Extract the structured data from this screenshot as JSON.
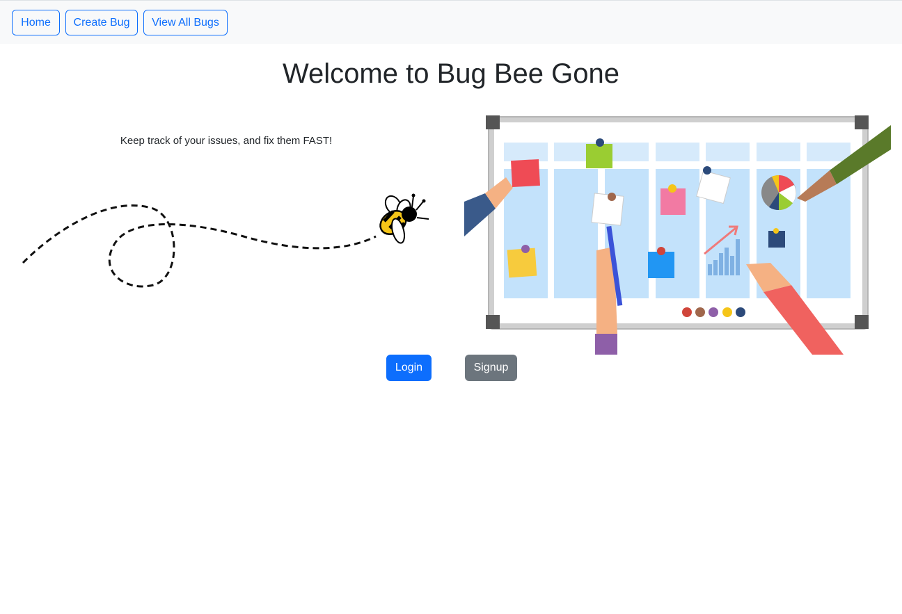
{
  "nav": {
    "home_label": "Home",
    "create_label": "Create Bug",
    "view_all_label": "View All Bugs"
  },
  "main": {
    "title": "Welcome to Bug Bee Gone",
    "tagline": "Keep track of your issues, and fix them FAST!",
    "login_label": "Login",
    "signup_label": "Signup"
  },
  "colors": {
    "primary": "#0d6efd",
    "secondary": "#6c757d",
    "navbar_bg": "#f8f9fa"
  },
  "icons": {
    "bee": "bee-icon",
    "board": "kanban-board-illustration"
  }
}
